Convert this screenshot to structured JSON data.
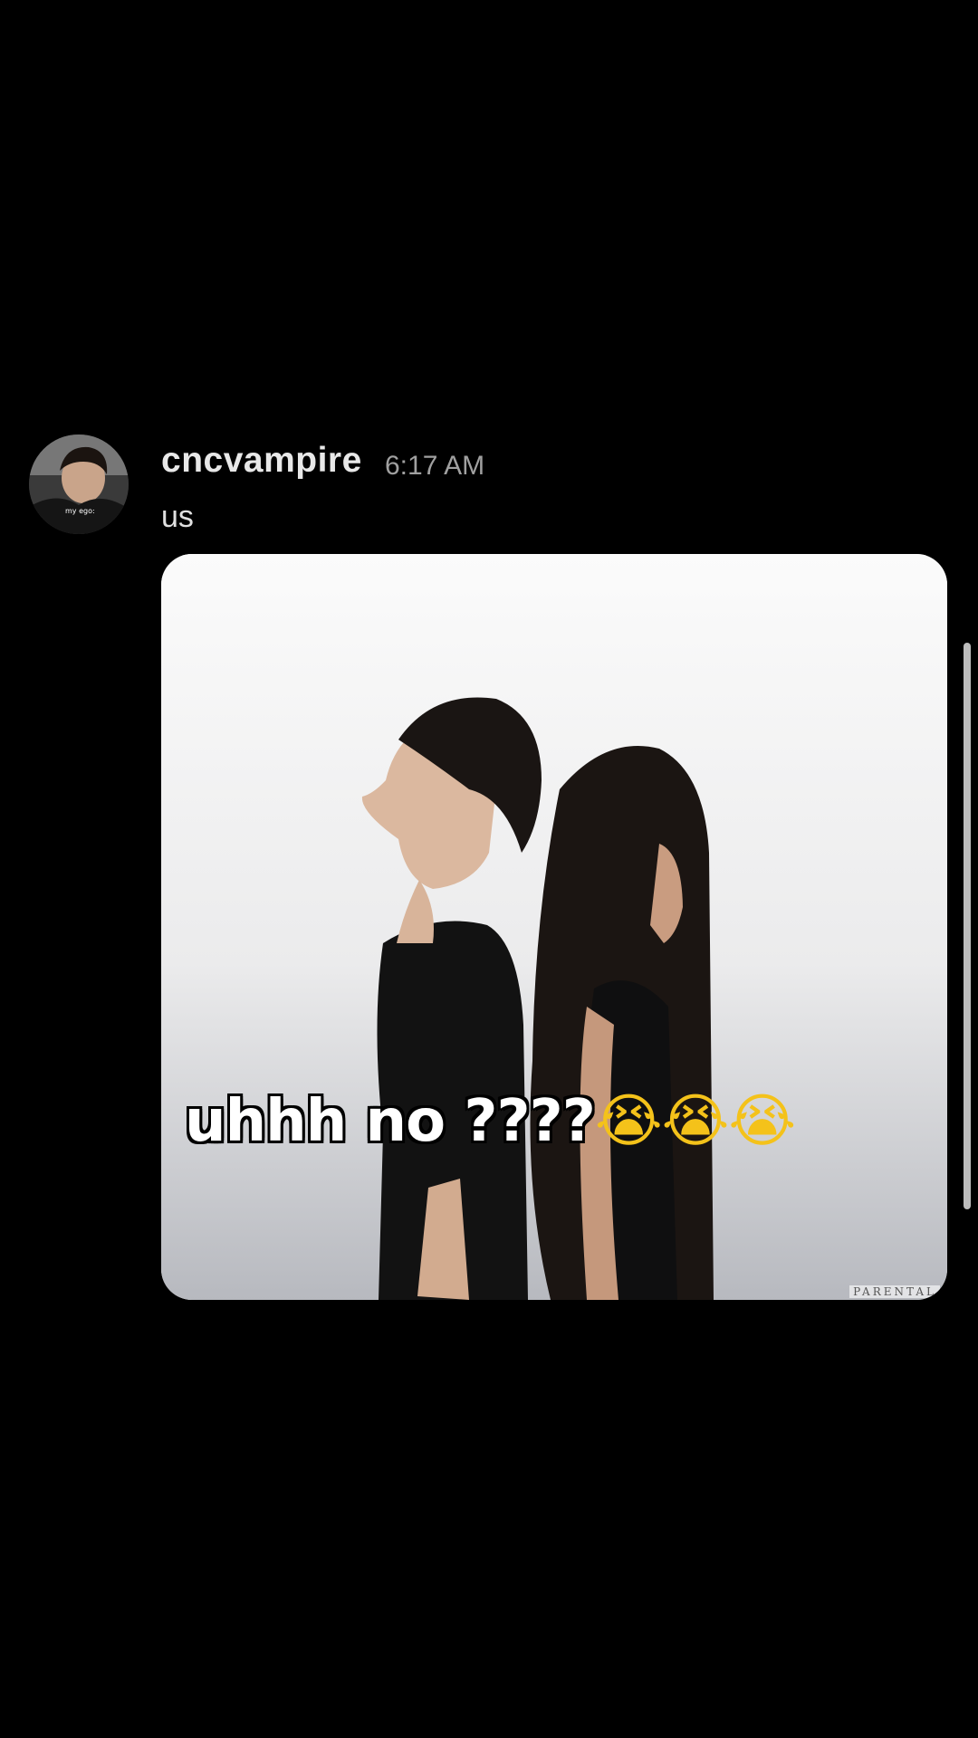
{
  "message": {
    "username": "cncvampire",
    "timestamp": "6:17 AM",
    "text": "us",
    "avatar": {
      "caption": "my ego:"
    },
    "attachment": {
      "caption_text": "uhhh no ????",
      "caption_emoji": "😭😭😭",
      "watermark": "PARENTAL"
    }
  },
  "colors": {
    "background": "#000000",
    "username": "#e8e8e8",
    "timestamp": "#a0a0a0",
    "scrollbar": "#bdbdbd"
  }
}
